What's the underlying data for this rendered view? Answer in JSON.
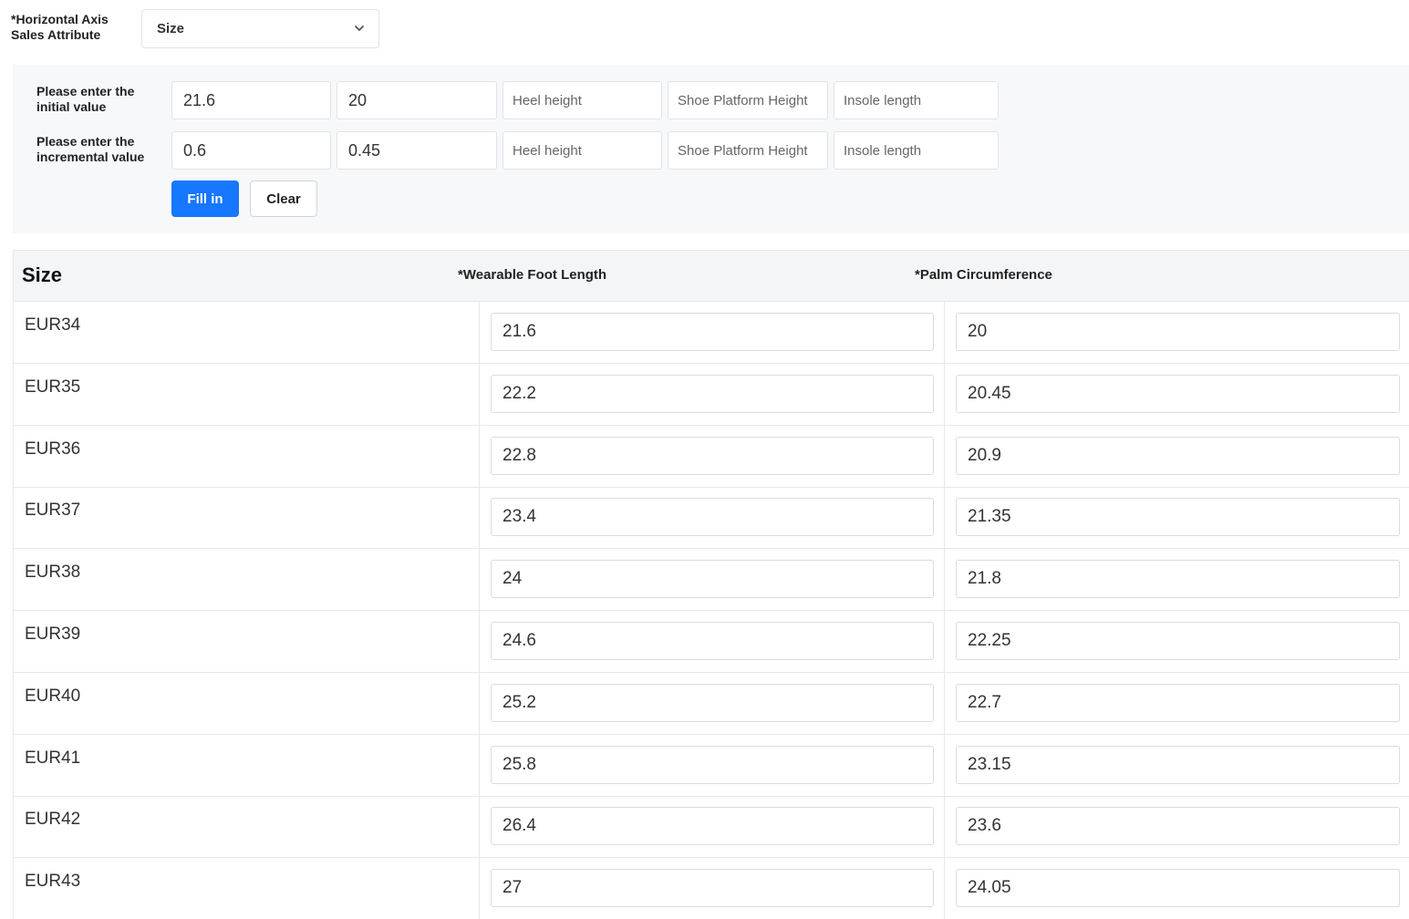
{
  "attribute": {
    "label": "*Horizontal Axis Sales Attribute",
    "selected": "Size"
  },
  "fill_panel": {
    "initial_label": "Please enter the initial value",
    "incremental_label": "Please enter the incremental value",
    "initial": {
      "foot_length": "21.6",
      "palm_circumference": "20",
      "heel_placeholder": "Heel height",
      "platform_placeholder": "Shoe Platform Height",
      "insole_placeholder": "Insole length"
    },
    "incremental": {
      "foot_length": "0.6",
      "palm_circumference": "0.45",
      "heel_placeholder": "Heel height",
      "platform_placeholder": "Shoe Platform Height",
      "insole_placeholder": "Insole length"
    },
    "fill_button": "Fill in",
    "clear_button": "Clear"
  },
  "table": {
    "headers": {
      "size": "Size",
      "foot_length": "*Wearable Foot Length",
      "palm_circumference": "*Palm Circumference"
    },
    "rows": [
      {
        "size": "EUR34",
        "foot_length": "21.6",
        "palm": "20"
      },
      {
        "size": "EUR35",
        "foot_length": "22.2",
        "palm": "20.45"
      },
      {
        "size": "EUR36",
        "foot_length": "22.8",
        "palm": "20.9"
      },
      {
        "size": "EUR37",
        "foot_length": "23.4",
        "palm": "21.35"
      },
      {
        "size": "EUR38",
        "foot_length": "24",
        "palm": "21.8"
      },
      {
        "size": "EUR39",
        "foot_length": "24.6",
        "palm": "22.25"
      },
      {
        "size": "EUR40",
        "foot_length": "25.2",
        "palm": "22.7"
      },
      {
        "size": "EUR41",
        "foot_length": "25.8",
        "palm": "23.15"
      },
      {
        "size": "EUR42",
        "foot_length": "26.4",
        "palm": "23.6"
      },
      {
        "size": "EUR43",
        "foot_length": "27",
        "palm": "24.05"
      }
    ]
  },
  "icons": {
    "dropdown": "chevron-down-icon"
  },
  "colors": {
    "primary": "#1677ff"
  }
}
